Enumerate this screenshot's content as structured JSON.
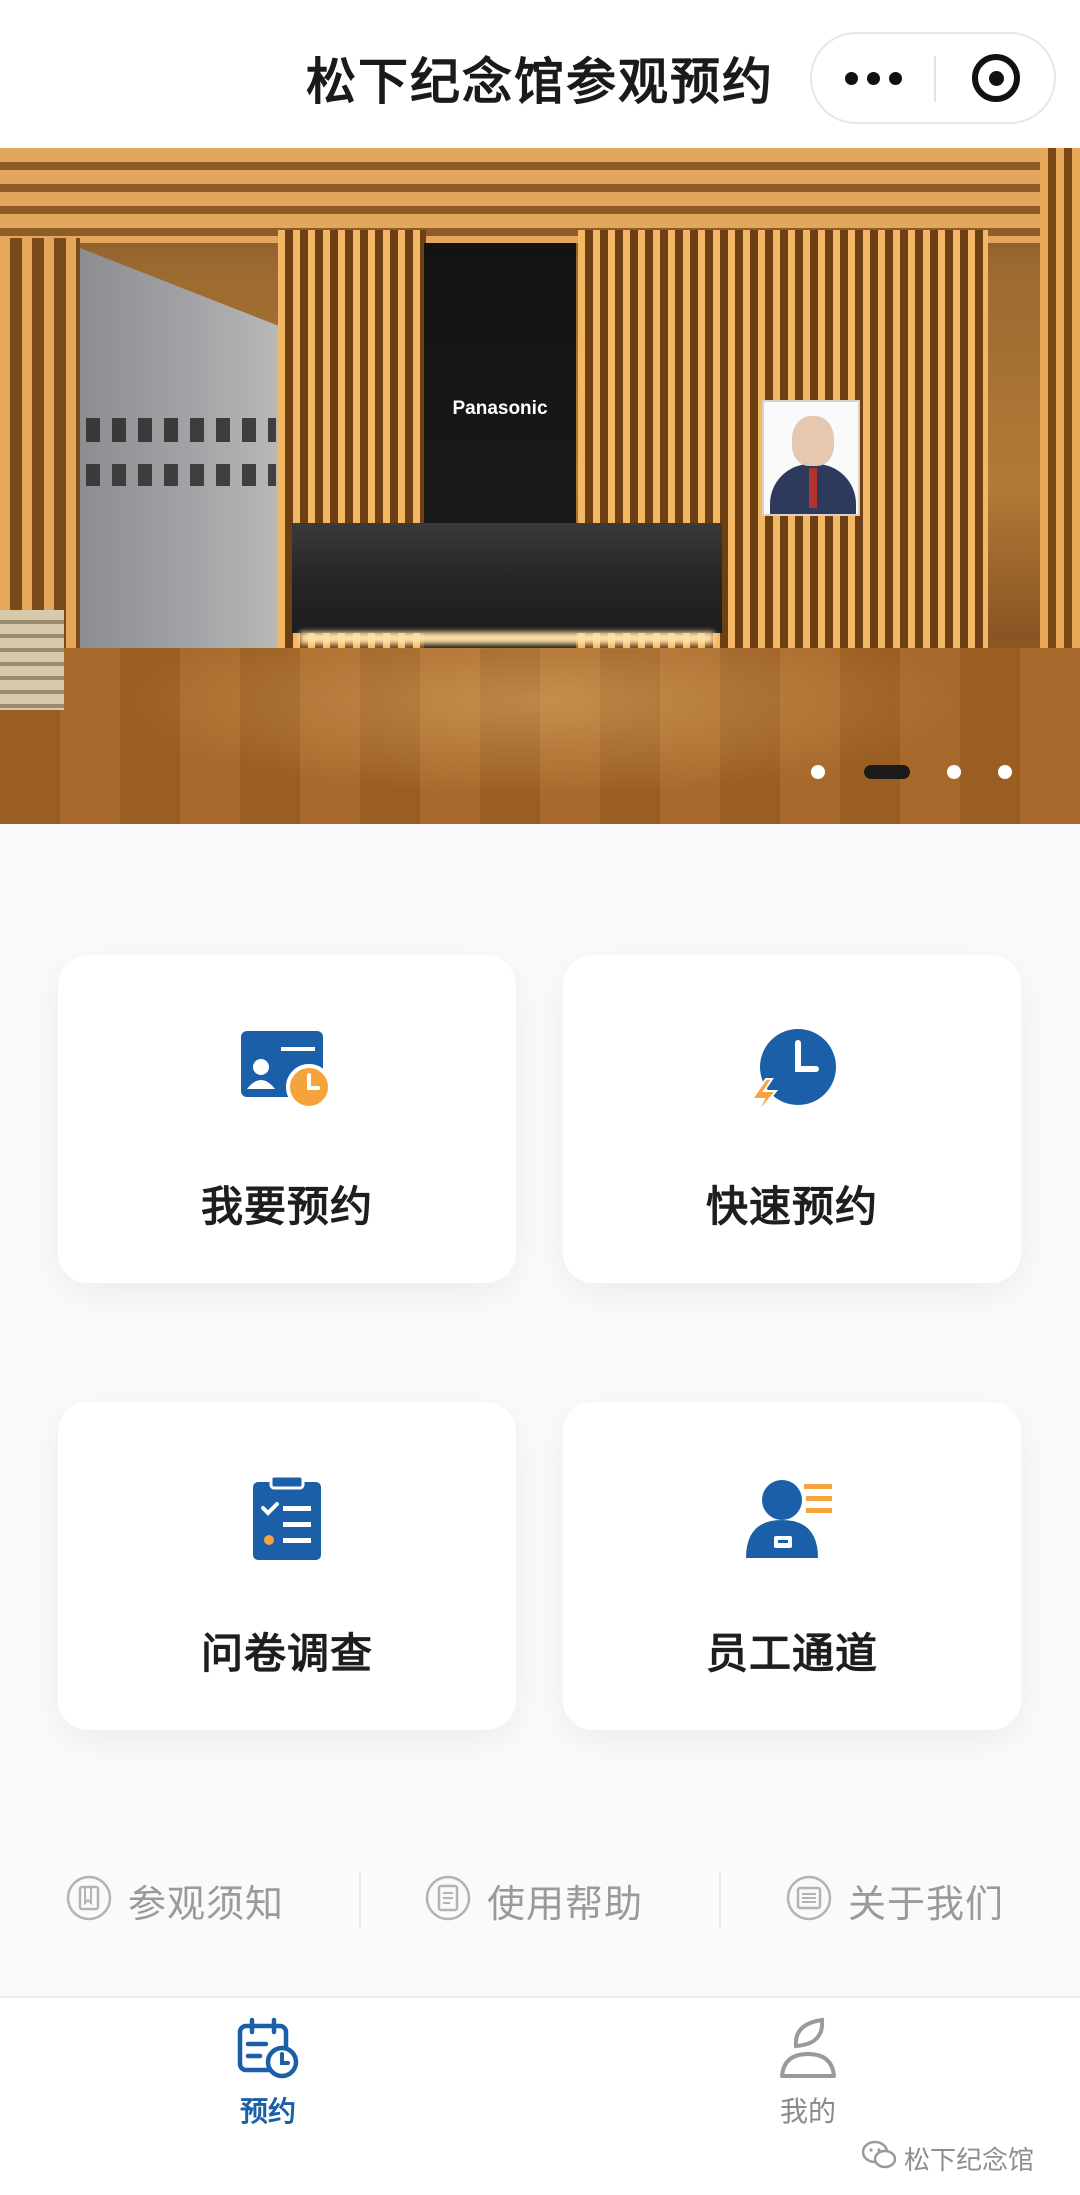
{
  "header": {
    "title": "松下纪念馆参观预约",
    "more_icon": "more-dots-icon",
    "close_icon": "target-circle-icon"
  },
  "banner": {
    "brand_sign": "Panasonic",
    "slide_count": 4,
    "active_slide_index": 1
  },
  "cards": [
    {
      "label": "我要预约",
      "icon": "id-card-clock-icon"
    },
    {
      "label": "快速预约",
      "icon": "clock-lightning-icon"
    },
    {
      "label": "问卷调查",
      "icon": "clipboard-checklist-icon"
    },
    {
      "label": "员工通道",
      "icon": "employee-badge-icon"
    }
  ],
  "links": [
    {
      "label": "参观须知",
      "icon": "book-icon"
    },
    {
      "label": "使用帮助",
      "icon": "document-icon"
    },
    {
      "label": "关于我们",
      "icon": "list-icon"
    }
  ],
  "tabbar": [
    {
      "label": "预约",
      "icon": "calendar-clock-icon",
      "active": true
    },
    {
      "label": "我的",
      "icon": "person-leaf-icon",
      "active": false
    }
  ],
  "watermark": {
    "text": "松下纪念馆",
    "icon": "wechat-icon"
  },
  "colors": {
    "primary_blue": "#1a5fa8",
    "accent_orange": "#f4a43a",
    "tab_active": "#1a5fa8",
    "muted_text": "#9a9a9a"
  }
}
